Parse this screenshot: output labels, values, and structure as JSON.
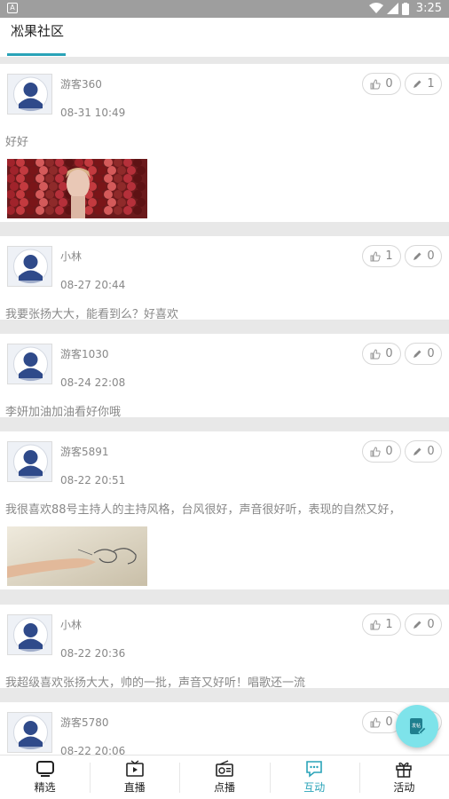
{
  "status_bar": {
    "time": "3:25",
    "left_badge": "A"
  },
  "header": {
    "title": "凇果社区"
  },
  "posts": [
    {
      "user": "游客360",
      "time": "08-31  10:49",
      "likes": "0",
      "comments": "1",
      "content": "好好",
      "image": "portrait-flowers"
    },
    {
      "user": "小林",
      "time": "08-27  20:44",
      "likes": "1",
      "comments": "0",
      "content": "我要张扬大大，能看到么？好喜欢",
      "image": ""
    },
    {
      "user": "游客1030",
      "time": "08-24  22:08",
      "likes": "0",
      "comments": "0",
      "content": "李妍加油加油看好你哦",
      "image": ""
    },
    {
      "user": "游客5891",
      "time": "08-22  20:51",
      "likes": "0",
      "comments": "0",
      "content": "我很喜欢88号主持人的主持风格，台风很好，声音很好听，表现的自然又好，",
      "image": "hand-sketch"
    },
    {
      "user": "小林",
      "time": "08-22  20:36",
      "likes": "1",
      "comments": "0",
      "content": "我超级喜欢张扬大大，帅的一批，声音又好听！唱歌还一流",
      "image": ""
    },
    {
      "user": "游客5780",
      "time": "08-22  20:06",
      "likes": "0",
      "comments": "",
      "content": "",
      "image": ""
    }
  ],
  "fab": {
    "label": "发帖",
    "icon": "post-edit-icon"
  },
  "nav": [
    {
      "label": "精选",
      "icon": "tv-icon"
    },
    {
      "label": "直播",
      "icon": "live-play-icon"
    },
    {
      "label": "点播",
      "icon": "radio-icon"
    },
    {
      "label": "互动",
      "icon": "chat-icon",
      "active": true
    },
    {
      "label": "活动",
      "icon": "gift-icon"
    }
  ],
  "colors": {
    "accent": "#2aa3b8",
    "fab": "#7ee3ea",
    "divider": "#e8e8e8"
  }
}
